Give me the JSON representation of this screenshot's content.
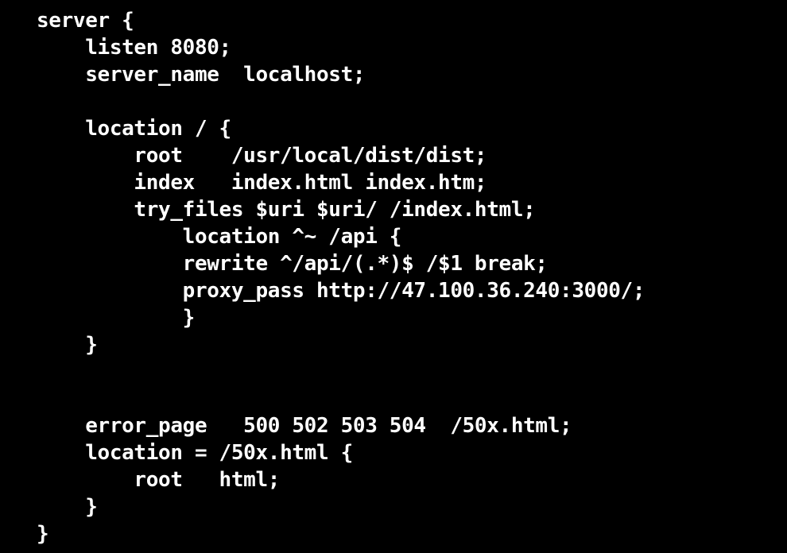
{
  "terminal": {
    "background_color": "#000000",
    "foreground_color": "#FFFFFF",
    "language": "nginx",
    "title": "nginx server block configuration"
  },
  "code": {
    "lines": [
      "server {",
      "    listen 8080;",
      "    server_name  localhost;",
      "",
      "    location / {",
      "        root    /usr/local/dist/dist;",
      "        index   index.html index.htm;",
      "        try_files $uri $uri/ /index.html;",
      "            location ^~ /api {",
      "            rewrite ^/api/(.*)$ /$1 break;",
      "            proxy_pass http://47.100.36.240:3000/;",
      "            }",
      "    }",
      "",
      "",
      "    error_page   500 502 503 504  /50x.html;",
      "    location = /50x.html {",
      "        root   html;",
      "    }",
      "}"
    ]
  }
}
